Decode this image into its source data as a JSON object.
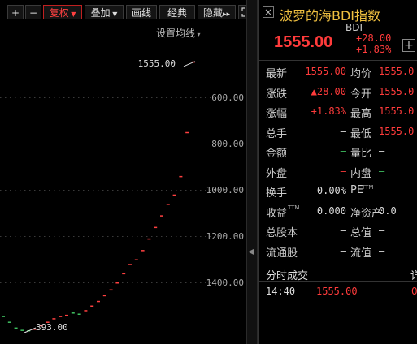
{
  "toolbar": {
    "plus": "+",
    "minus": "−",
    "adjust": "复权",
    "overlay": "叠加",
    "draw": "画线",
    "classic": "经典",
    "hide": "隐藏",
    "hide_arrows": "▸▸",
    "fullscreen_icon": "fullscreen-icon"
  },
  "chart": {
    "settings_label": "设置均线",
    "high_label": "1555.00",
    "low_label": "393.00",
    "y_ticks": [
      "1400.00",
      "1200.00",
      "1000.00",
      "800.00",
      "600.00"
    ]
  },
  "chart_data": {
    "type": "scatter",
    "ylim": [
      393,
      1555
    ],
    "y_ticks": [
      600,
      800,
      1000,
      1200,
      1400
    ],
    "points": [
      {
        "y": 455,
        "c": "green"
      },
      {
        "y": 430,
        "c": "green"
      },
      {
        "y": 405,
        "c": "green"
      },
      {
        "y": 395,
        "c": "green"
      },
      {
        "y": 393,
        "c": "green"
      },
      {
        "y": 400,
        "c": "red"
      },
      {
        "y": 415,
        "c": "red"
      },
      {
        "y": 430,
        "c": "red"
      },
      {
        "y": 445,
        "c": "red"
      },
      {
        "y": 455,
        "c": "red"
      },
      {
        "y": 460,
        "c": "red"
      },
      {
        "y": 470,
        "c": "green"
      },
      {
        "y": 465,
        "c": "green"
      },
      {
        "y": 480,
        "c": "red"
      },
      {
        "y": 500,
        "c": "red"
      },
      {
        "y": 520,
        "c": "red"
      },
      {
        "y": 545,
        "c": "red"
      },
      {
        "y": 570,
        "c": "red"
      },
      {
        "y": 600,
        "c": "red"
      },
      {
        "y": 640,
        "c": "red"
      },
      {
        "y": 680,
        "c": "red"
      },
      {
        "y": 700,
        "c": "red"
      },
      {
        "y": 740,
        "c": "red"
      },
      {
        "y": 790,
        "c": "red"
      },
      {
        "y": 840,
        "c": "red"
      },
      {
        "y": 890,
        "c": "red"
      },
      {
        "y": 940,
        "c": "red"
      },
      {
        "y": 980,
        "c": "red"
      },
      {
        "y": 1060,
        "c": "red"
      },
      {
        "y": 1250,
        "c": "red"
      },
      {
        "y": 1555,
        "c": "red"
      }
    ]
  },
  "panel": {
    "title": "波罗的海BDI指数",
    "code": "BDI",
    "price": "1555.00",
    "change": "+28.00",
    "change_pct": "+1.83%",
    "close_icon": "close-icon",
    "add_icon": "add-icon",
    "rows": [
      {
        "l1": "最新",
        "v1": "1555.00",
        "c1": "red",
        "l2": "均价",
        "v2": "1555.0",
        "c2": "red"
      },
      {
        "l1": "涨跌",
        "v1": "▲28.00",
        "c1": "red",
        "l2": "今开",
        "v2": "1555.0",
        "c2": "red"
      },
      {
        "l1": "涨幅",
        "v1": "+1.83%",
        "c1": "red",
        "l2": "最高",
        "v2": "1555.0",
        "c2": "red"
      },
      {
        "l1": "总手",
        "v1": "—",
        "c1": "white",
        "l2": "最低",
        "v2": "1555.0",
        "c2": "red"
      },
      {
        "l1": "金额",
        "v1": "—",
        "c1": "green",
        "l2": "量比",
        "v2": "—",
        "c2": "white"
      },
      {
        "l1": "外盘",
        "v1": "—",
        "c1": "red",
        "l2": "内盘",
        "v2": "—",
        "c2": "green"
      },
      {
        "l1": "换手",
        "v1": "0.00%",
        "c1": "white",
        "l2": "PE",
        "v2": "—",
        "c2": "white"
      },
      {
        "l1": "收益",
        "v1": "0.000",
        "c1": "white",
        "l2": "净资产",
        "v2": "0.0",
        "c2": "white"
      },
      {
        "l1": "总股本",
        "v1": "—",
        "c1": "white",
        "l2": "总值",
        "v2": "—",
        "c2": "white"
      },
      {
        "l1": "流通股",
        "v1": "—",
        "c1": "white",
        "l2": "流值",
        "v2": "—",
        "c2": "white"
      }
    ],
    "pe_sup": "TTM",
    "eps_sup": "TTM",
    "ticks_header": "分时成交",
    "ticks_header_right": "详",
    "tick": {
      "time": "14:40",
      "price": "1555.00",
      "extra": "0"
    }
  }
}
